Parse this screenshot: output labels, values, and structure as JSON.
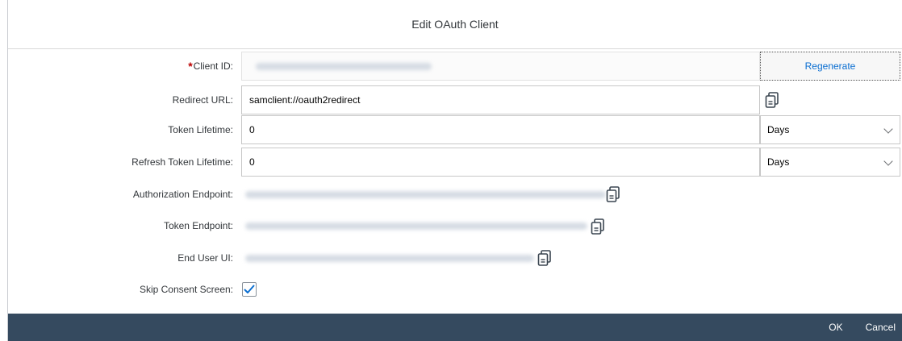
{
  "dialog": {
    "title": "Edit OAuth Client"
  },
  "fields": {
    "client_id": {
      "required_mark": "*",
      "label": "Client ID:",
      "regenerate_label": "Regenerate"
    },
    "redirect_url": {
      "label": "Redirect URL:",
      "value": "samclient://oauth2redirect"
    },
    "token_lifetime": {
      "label": "Token Lifetime:",
      "value": "0",
      "unit": "Days"
    },
    "refresh_token_lifetime": {
      "label": "Refresh Token Lifetime:",
      "value": "0",
      "unit": "Days"
    },
    "authorization_endpoint": {
      "label": "Authorization Endpoint:"
    },
    "token_endpoint": {
      "label": "Token Endpoint:"
    },
    "end_user_ui": {
      "label": "End User UI:"
    },
    "skip_consent_screen": {
      "label": "Skip Consent Screen:",
      "checked": true
    }
  },
  "footer": {
    "ok_label": "OK",
    "cancel_label": "Cancel"
  },
  "colors": {
    "accent": "#0a6ed1",
    "footer_bg": "#354a5f",
    "required": "#bb0000"
  },
  "icons": {
    "copy": "copy-to-clipboard-icon",
    "dropdown": "chevron-down-icon",
    "check": "checkmark-icon"
  }
}
